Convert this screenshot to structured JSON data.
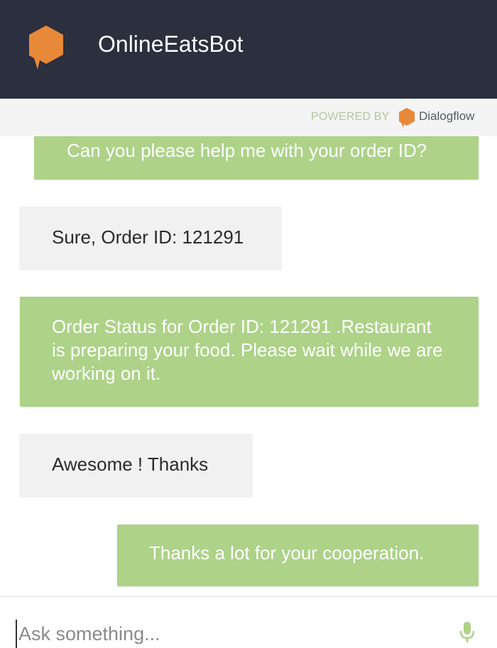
{
  "header": {
    "title": "OnlineEatsBot",
    "logo_icon": "speech-bubble-icon",
    "logo_color": "#e8893a",
    "background": "#2b2f3e"
  },
  "powered_by": {
    "label": "POWERED BY",
    "brand": "Dialogflow",
    "brand_icon": "dialogflow-icon"
  },
  "messages": [
    {
      "sender": "bot",
      "text": "Can you please help me with your order ID?"
    },
    {
      "sender": "user",
      "text": "Sure, Order ID: 121291"
    },
    {
      "sender": "bot",
      "text": "Order Status for Order ID: 121291 .Restaurant is preparing your food. Please wait while we are working on it."
    },
    {
      "sender": "user",
      "text": "Awesome ! Thanks"
    },
    {
      "sender": "bot",
      "text": "Thanks a lot for your cooperation."
    }
  ],
  "input": {
    "placeholder": "Ask something...",
    "value": "",
    "mic_icon": "microphone-icon"
  },
  "colors": {
    "bot_bubble": "#add288",
    "user_bubble": "#f1f1f1",
    "accent": "#e8893a"
  }
}
